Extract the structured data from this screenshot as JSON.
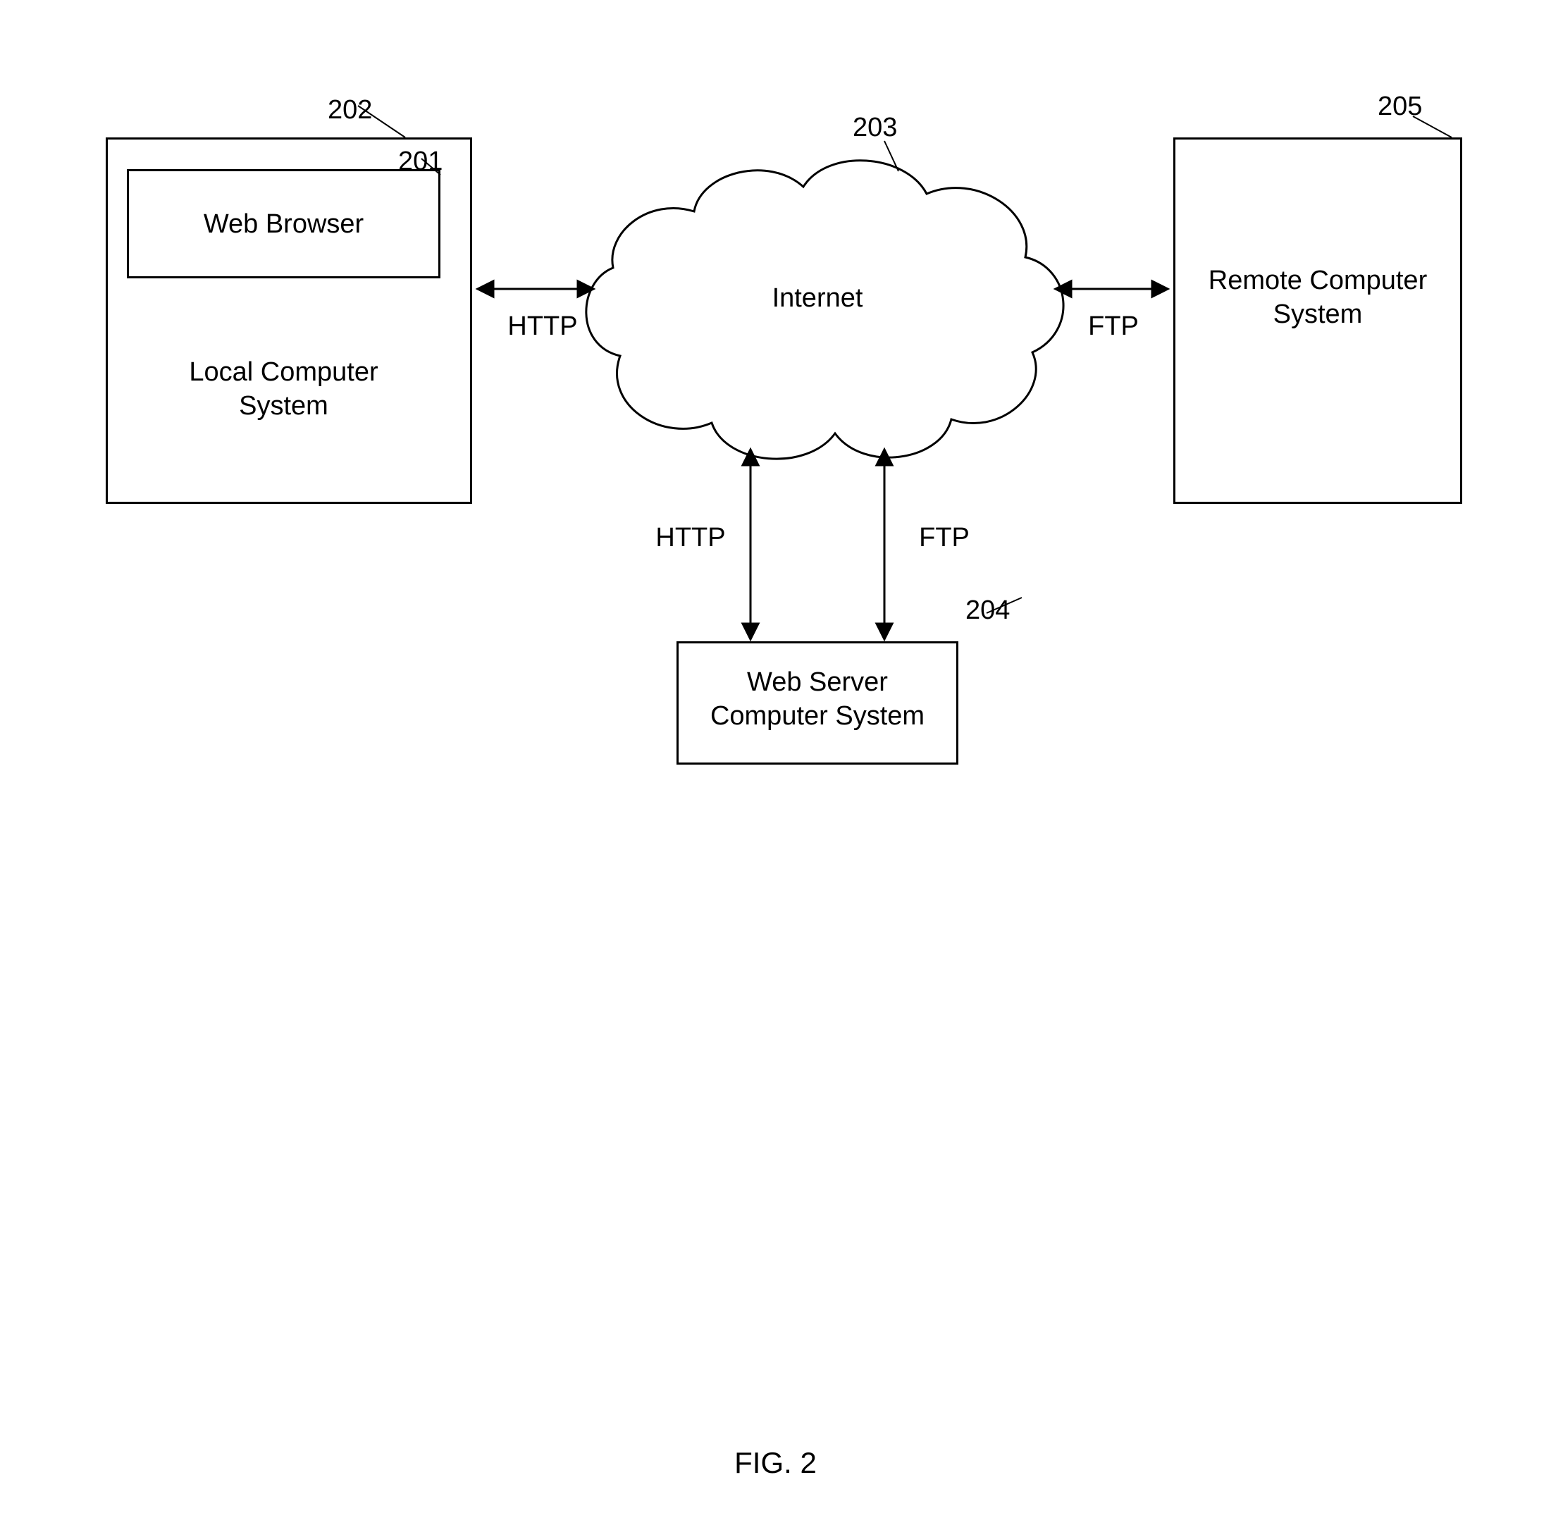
{
  "figure_caption": "FIG. 2",
  "nodes": {
    "local_system": {
      "ref": "202",
      "label": "Local Computer\nSystem"
    },
    "web_browser": {
      "ref": "201",
      "label": "Web Browser"
    },
    "internet": {
      "ref": "203",
      "label": "Internet"
    },
    "web_server": {
      "ref": "204",
      "label": "Web Server\nComputer System"
    },
    "remote_system": {
      "ref": "205",
      "label": "Remote Computer\nSystem"
    }
  },
  "edges": {
    "local_to_internet": {
      "label": "HTTP"
    },
    "internet_to_remote": {
      "label": "FTP"
    },
    "internet_to_server_l": {
      "label": "HTTP"
    },
    "internet_to_server_r": {
      "label": "FTP"
    }
  }
}
